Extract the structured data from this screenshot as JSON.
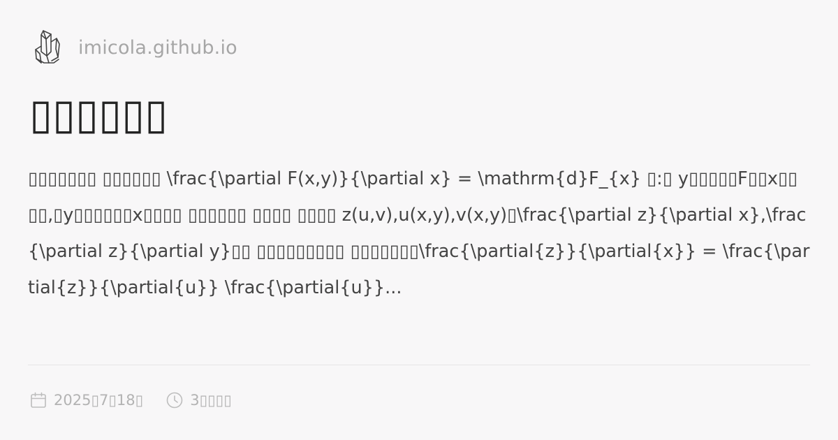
{
  "site": {
    "logo_icon": "crystal-cluster-logo",
    "name": "imicola.github.io"
  },
  "post": {
    "title": "▯▯▯▯▯▯",
    "excerpt": "▯▯▯▯▯▯▯ ▯▯▯▯▯▯ \\frac{\\partial F(x,y)}{\\partial x} = \\mathrm{d}F_{x} ▯:▯ y▯▯▯▯▯F▯▯x▯▯ ▯▯,▯y▯▯▯▯▯▯x▯▯▯▯ ▯▯▯▯▯▯ ▯▯▯▯ ▯▯▯▯ z(u,v),u(x,y),v(x,y)▯\\frac{\\partial z}{\\partial x},\\frac{\\partial z}{\\partial y}▯▯ ▯▯▯▯▯▯▯▯▯ ▯▯▯▯▯▯▯\\frac{\\partial{z}}{\\partial{x}} = \\frac{\\partial{z}}{\\partial{u}} \\frac{\\partial{u}}..."
  },
  "meta": {
    "date_icon": "calendar-icon",
    "date": "2025▯7▯18▯",
    "read_time_icon": "clock-icon",
    "read_time": "3▯▯▯▯"
  },
  "colors": {
    "background": "#f8f7f8",
    "title": "#222222",
    "body_text": "#444444",
    "muted": "#a6a6a6"
  }
}
